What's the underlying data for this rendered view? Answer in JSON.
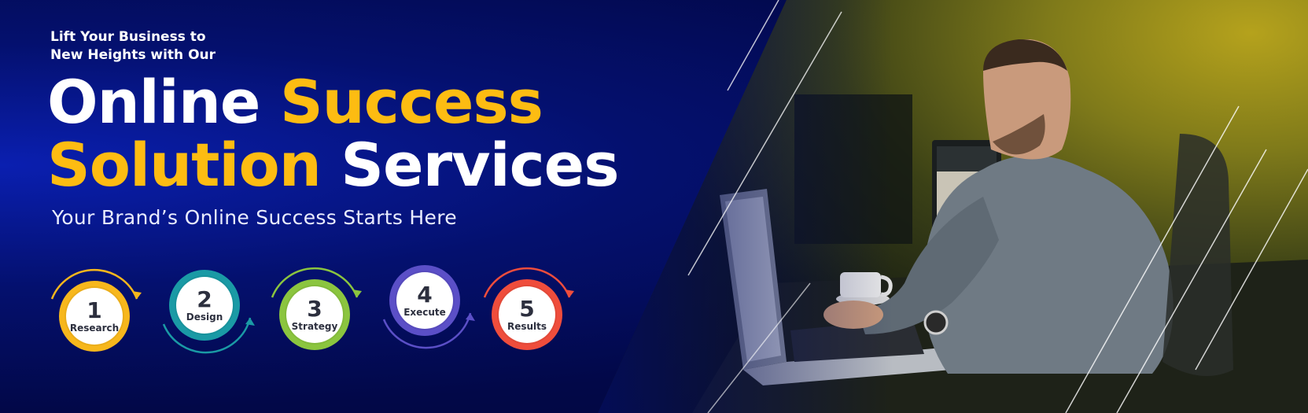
{
  "banner": {
    "intro_line1": "Lift Your Business to",
    "intro_line2": "New Heights with Our",
    "title_word1": "Online",
    "title_word2": "Success",
    "title_word3": "Solution",
    "title_word4": "Services",
    "tagline": "Your Brand’s Online Success Starts Here"
  },
  "colors": {
    "accent_yellow": "#fdbc12",
    "background_blue": "#04106e"
  },
  "steps": [
    {
      "number": "1",
      "label": "Research",
      "color": "#f7b71c"
    },
    {
      "number": "2",
      "label": "Design",
      "color": "#1a9aa5"
    },
    {
      "number": "3",
      "label": "Strategy",
      "color": "#8bc53f"
    },
    {
      "number": "4",
      "label": "Execute",
      "color": "#5b4fc7"
    },
    {
      "number": "5",
      "label": "Results",
      "color": "#ef4d3c"
    }
  ],
  "photo": {
    "subject": "man-typing-on-laptop-photo"
  }
}
